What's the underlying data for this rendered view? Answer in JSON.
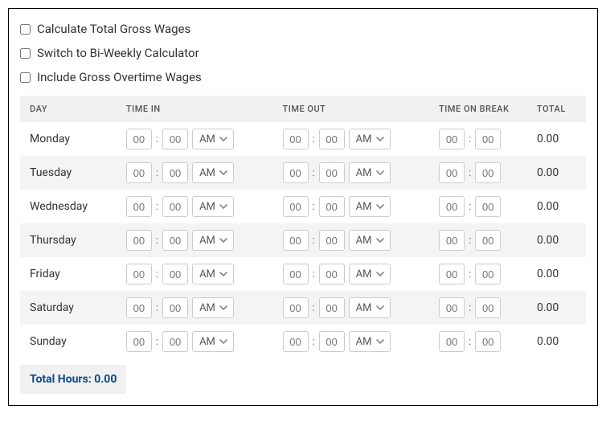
{
  "options": {
    "calc_gross": "Calculate Total Gross Wages",
    "biweekly": "Switch to Bi-Weekly Calculator",
    "overtime": "Include Gross Overtime Wages"
  },
  "headers": {
    "day": "DAY",
    "time_in": "TIME IN",
    "time_out": "TIME OUT",
    "on_break": "TIME ON BREAK",
    "total": "TOTAL"
  },
  "placeholder": "00",
  "ampm_default": "AM",
  "rows": [
    {
      "day": "Monday",
      "total": "0.00"
    },
    {
      "day": "Tuesday",
      "total": "0.00"
    },
    {
      "day": "Wednesday",
      "total": "0.00"
    },
    {
      "day": "Thursday",
      "total": "0.00"
    },
    {
      "day": "Friday",
      "total": "0.00"
    },
    {
      "day": "Saturday",
      "total": "0.00"
    },
    {
      "day": "Sunday",
      "total": "0.00"
    }
  ],
  "footer": {
    "label": "Total Hours:",
    "value": "0.00"
  }
}
